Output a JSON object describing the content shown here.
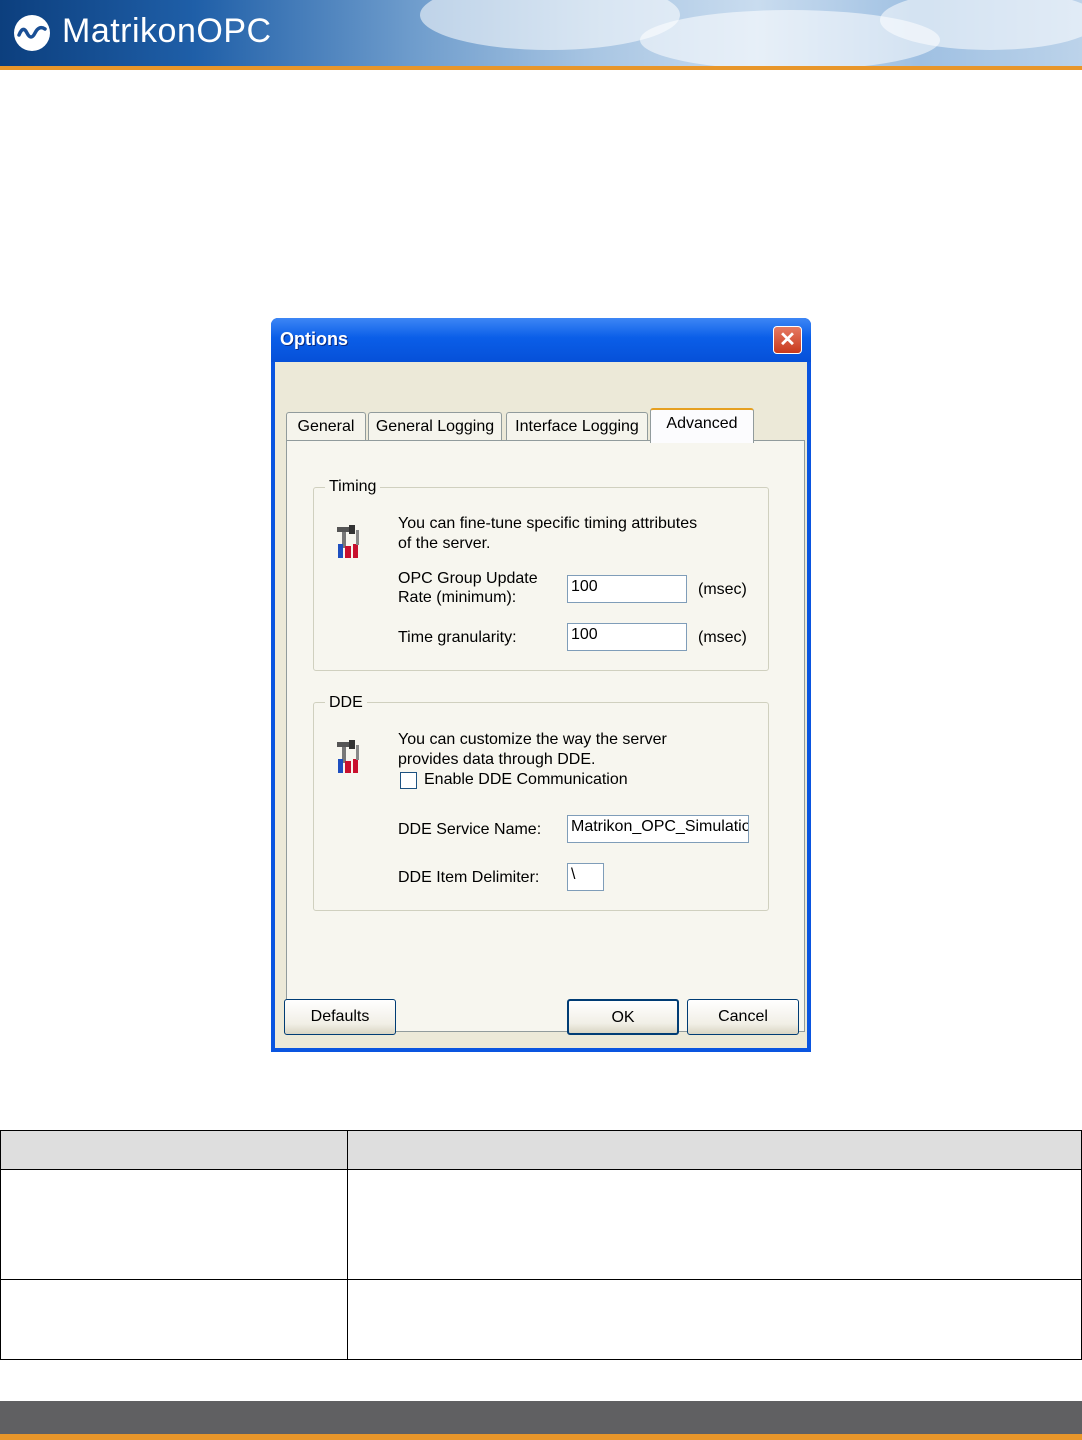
{
  "header": {
    "brand": "MatrikonOPC",
    "logo_icon": "matrikon-wave-logo"
  },
  "dialog": {
    "title": "Options",
    "close_icon": "close-icon",
    "tabs": [
      {
        "label": "General",
        "active": false
      },
      {
        "label": "General Logging",
        "active": false
      },
      {
        "label": "Interface Logging",
        "active": false
      },
      {
        "label": "Advanced",
        "active": true
      }
    ],
    "timing": {
      "legend": "Timing",
      "icon": "tools-icon",
      "description_line1": "You can fine-tune specific timing attributes",
      "description_line2": "of the server.",
      "update_rate_label_line1": "OPC Group Update",
      "update_rate_label_line2": "Rate (minimum):",
      "update_rate_value": "100",
      "update_rate_unit": "(msec)",
      "granularity_label": "Time granularity:",
      "granularity_value": "100",
      "granularity_unit": "(msec)"
    },
    "dde": {
      "legend": "DDE",
      "icon": "tools-icon",
      "description_line1": "You can customize the way the server",
      "description_line2": "provides data through DDE.",
      "enable_label": "Enable DDE Communication",
      "enable_checked": false,
      "service_name_label": "DDE Service Name:",
      "service_name_value": "Matrikon_OPC_Simulatio",
      "delimiter_label": "DDE Item Delimiter:",
      "delimiter_value": "\\"
    },
    "buttons": {
      "defaults": "Defaults",
      "ok": "OK",
      "cancel": "Cancel"
    }
  },
  "colors": {
    "accent_orange": "#e8962a",
    "xp_blue": "#0a55e0",
    "dialog_face": "#ece9d8"
  }
}
